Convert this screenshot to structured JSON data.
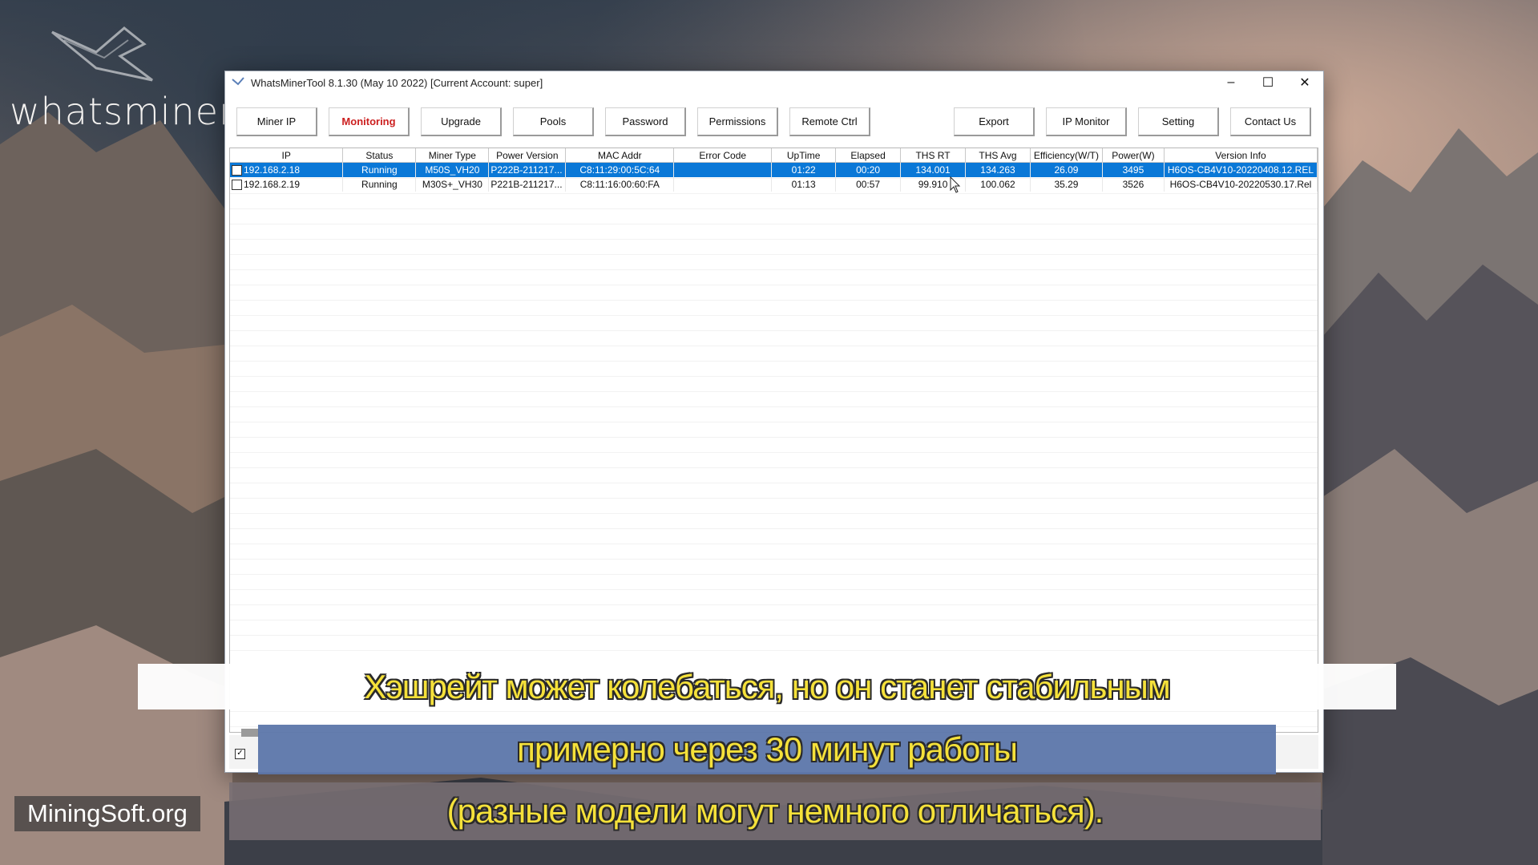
{
  "brand": {
    "text": "whatsminer"
  },
  "site_badge": "MiningSoft.org",
  "window": {
    "title": "WhatsMinerTool 8.1.30 (May 10 2022) [Current Account: super]",
    "controls": {
      "minimize": "–",
      "maximize": "☐",
      "close": "✕"
    }
  },
  "toolbar": {
    "buttons": [
      "Miner IP",
      "Monitoring",
      "Upgrade",
      "Pools",
      "Password",
      "Permissions",
      "Remote Ctrl",
      "Export",
      "IP Monitor",
      "Setting",
      "Contact Us"
    ],
    "active": "Monitoring"
  },
  "table": {
    "columns": [
      "IP",
      "Status",
      "Miner Type",
      "Power Version",
      "MAC Addr",
      "Error Code",
      "UpTime",
      "Elapsed",
      "THS RT",
      "THS Avg",
      "Efficiency(W/T)",
      "Power(W)",
      "Version Info"
    ],
    "rows": [
      [
        "192.168.2.18",
        "Running",
        "M50S_VH20",
        "P222B-211217...",
        "C8:11:29:00:5C:64",
        "",
        "01:22",
        "00:20",
        "134.001",
        "134.263",
        "26.09",
        "3495",
        "H6OS-CB4V10-20220408.12.REL"
      ],
      [
        "192.168.2.19",
        "Running",
        "M30S+_VH30",
        "P221B-211217...",
        "C8:11:16:00:60:FA",
        "",
        "01:13",
        "00:57",
        "99.910",
        "100.062",
        "35.29",
        "3526",
        "H6OS-CB4V10-20220530.17.Rel"
      ]
    ],
    "selected_row": 0
  },
  "subtitles": [
    "Хэшрейт может колебаться, но он станет стабильным",
    "примерно через 30 минут работы",
    "(разные модели могут немного отличаться)."
  ],
  "colors": {
    "selection": "#0a78d7",
    "active_tab": "#cc2020",
    "subtitle": "#f5e13a"
  }
}
